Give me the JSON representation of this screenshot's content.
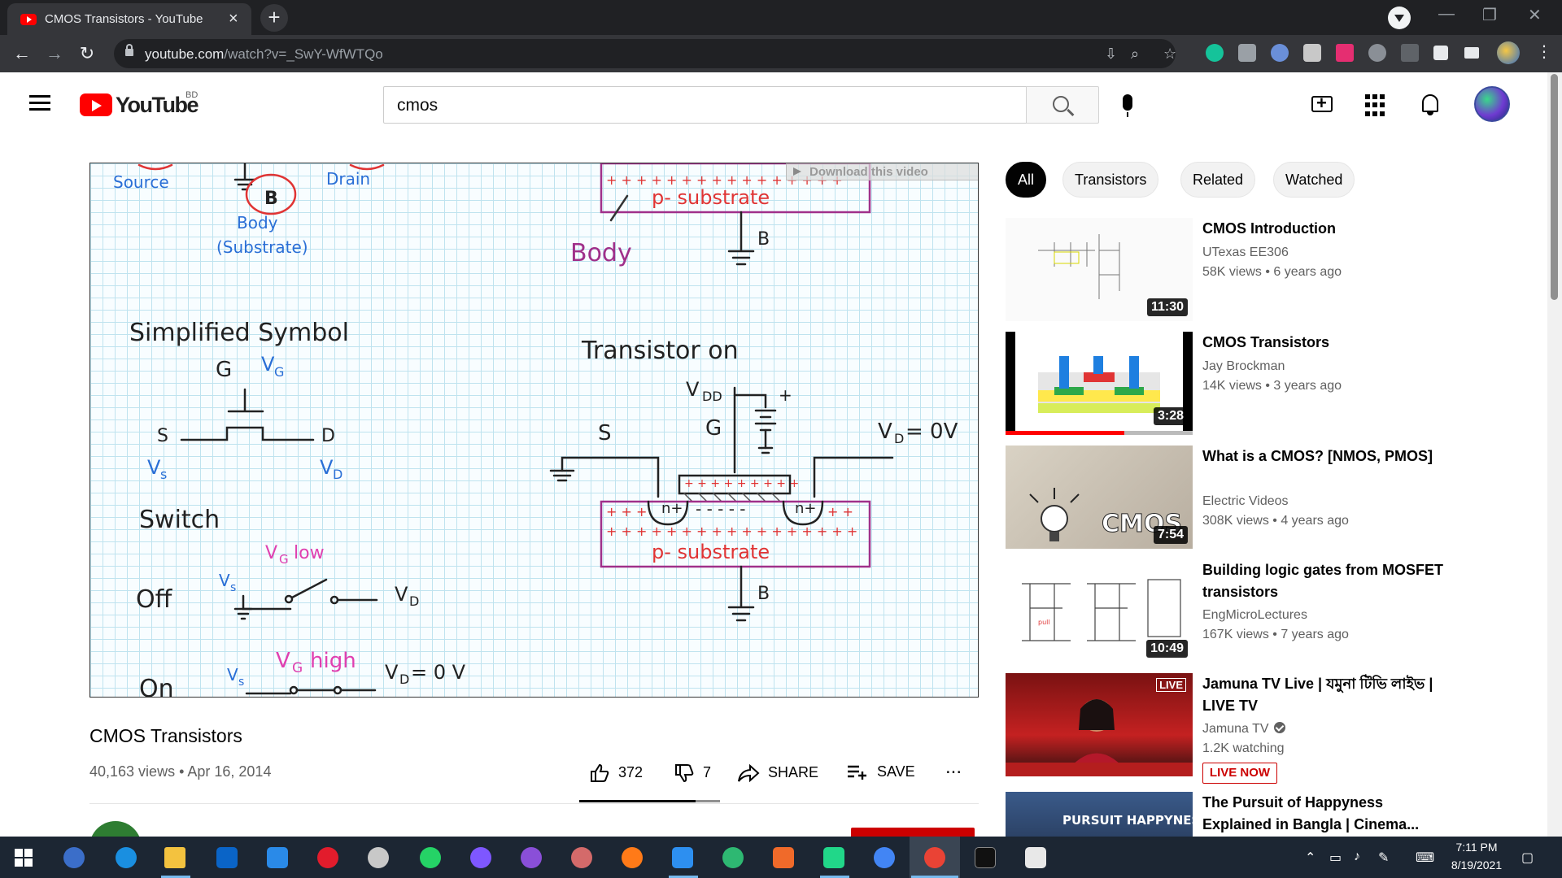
{
  "browser": {
    "tab_title": "CMOS Transistors - YouTube",
    "new_tab": "+",
    "url_main": "youtube.com",
    "url_path": "/watch?v=_SwY-WfWTQo"
  },
  "header": {
    "logo": "YouTube",
    "country": "BD",
    "search_value": "cmos"
  },
  "player": {
    "download_label": "Download this video"
  },
  "video": {
    "title": "CMOS Transistors",
    "meta": "40,163 views • Apr 16, 2014",
    "likes": "372",
    "dislikes": "7",
    "share_label": "SHARE",
    "save_label": "SAVE",
    "more": "..."
  },
  "chips": [
    "All",
    "Transistors",
    "Related",
    "Watched"
  ],
  "recommendations": [
    {
      "title": "CMOS Introduction",
      "channel": "UTexas EE306",
      "stats": "58K views • 6 years ago",
      "duration": "11:30"
    },
    {
      "title": "CMOS Transistors",
      "channel": "Jay Brockman",
      "stats": "14K views • 3 years ago",
      "duration": "3:28",
      "watched_fraction": 0.63
    },
    {
      "title": "What is a CMOS? [NMOS, PMOS]",
      "channel": "Electric Videos",
      "stats": "308K views • 4 years ago",
      "duration": "7:54",
      "thumb_text": "CMOS"
    },
    {
      "title": "Building logic gates from MOSFET transistors",
      "channel": "EngMicroLectures",
      "stats": "167K views • 7 years ago",
      "duration": "10:49"
    },
    {
      "title": "Jamuna TV Live | যমুনা টিভি লাইভ | LIVE TV",
      "channel": "Jamuna TV",
      "stats": "1.2K watching",
      "live_badge": "LIVE NOW",
      "thumb_tag": "LIVE"
    },
    {
      "title": "The Pursuit of Happyness Explained in Bangla | Cinema...",
      "thumb_text": "PURSUIT HAPPYNESS"
    }
  ],
  "taskbar": {
    "time": "7:11 PM",
    "date": "8/19/2021"
  },
  "colors": {
    "youtube_red": "#ff0000",
    "chrome_dark": "#202124",
    "taskbar": "#1c2633"
  }
}
